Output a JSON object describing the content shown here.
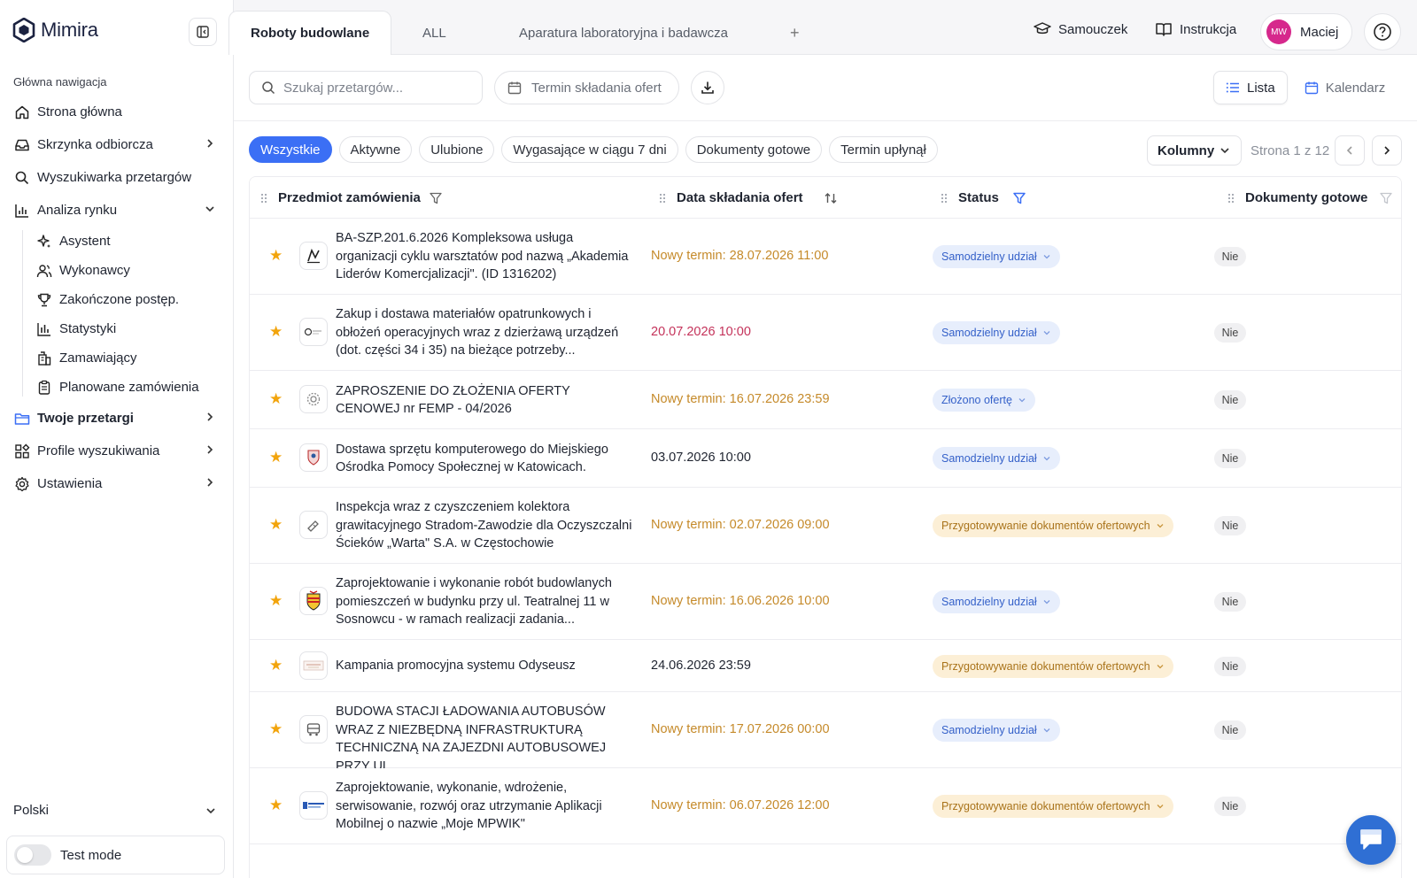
{
  "app": {
    "name": "Mimira"
  },
  "tabs": {
    "items": [
      {
        "label": "Roboty budowlane"
      },
      {
        "label": "ALL"
      },
      {
        "label": "Aparatura laboratoryjna i badawcza"
      }
    ],
    "add_label": "+"
  },
  "top_actions": {
    "tutorial_label": "Samouczek",
    "manual_label": "Instrukcja",
    "user_initials": "MW",
    "user_name": "Maciej"
  },
  "sidebar": {
    "heading": "Główna nawigacja",
    "items": [
      {
        "label": "Strona główna",
        "icon": "home-icon"
      },
      {
        "label": "Skrzynka odbiorcza",
        "icon": "inbox-icon"
      },
      {
        "label": "Wyszukiwarka przetargów",
        "icon": "search-icon"
      },
      {
        "label": "Analiza rynku",
        "icon": "chart-icon"
      }
    ],
    "subitems": [
      {
        "label": "Asystent",
        "icon": "sparkles-icon"
      },
      {
        "label": "Wykonawcy",
        "icon": "users-icon"
      },
      {
        "label": "Zakończone postęp.",
        "icon": "trophy-icon"
      },
      {
        "label": "Statystyki",
        "icon": "bar-chart-icon"
      },
      {
        "label": "Zamawiający",
        "icon": "building-icon"
      },
      {
        "label": "Planowane zamówienia",
        "icon": "clipboard-icon"
      }
    ],
    "items_after": [
      {
        "label": "Twoje przetargi",
        "icon": "folder-icon"
      },
      {
        "label": "Profile wyszukiwania",
        "icon": "widgets-icon"
      },
      {
        "label": "Ustawienia",
        "icon": "gear-icon"
      }
    ],
    "language": "Polski",
    "test_mode_label": "Test mode"
  },
  "toolbar": {
    "search_placeholder": "Szukaj przetargów...",
    "date_filter_label": "Termin składania ofert",
    "view_list_label": "Lista",
    "view_calendar_label": "Kalendarz"
  },
  "filters": {
    "chips": [
      "Wszystkie",
      "Aktywne",
      "Ulubione",
      "Wygasające w ciągu 7 dni",
      "Dokumenty gotowe",
      "Termin upłynął"
    ],
    "columns_label": "Kolumny",
    "page_info": "Strona 1 z 12"
  },
  "table": {
    "headers": {
      "subject": "Przedmiot zamówienia",
      "date": "Data składania ofert",
      "status": "Status",
      "docs": "Dokumenty gotowe"
    },
    "rows": [
      {
        "subject": "BA-SZP.201.6.2026 Kompleksowa usługa organizacji cyklu warsztatów pod nazwą „Akademia Liderów Komercjalizacji\". (ID 1316202)",
        "date": "Nowy termin: 28.07.2026 11:00",
        "date_style": "orange",
        "status": "Samodzielny udział",
        "status_style": "blue",
        "docs": "Nie",
        "lines": 3
      },
      {
        "subject": "Zakup i dostawa materiałów opatrunkowych i obłożeń operacyjnych wraz z dzierżawą urządzeń (dot. części 34 i 35) na bieżące potrzeby...",
        "date": "20.07.2026 10:00",
        "date_style": "red",
        "status": "Samodzielny udział",
        "status_style": "blue",
        "docs": "Nie",
        "lines": 3
      },
      {
        "subject": "ZAPROSZENIE DO ZŁOŻENIA OFERTY CENOWEJ nr FEMP - 04/2026",
        "date": "Nowy termin: 16.07.2026 23:59",
        "date_style": "orange",
        "status": "Złożono ofertę",
        "status_style": "blue",
        "docs": "Nie",
        "lines": 2
      },
      {
        "subject": "Dostawa sprzętu komputerowego do Miejskiego Ośrodka Pomocy Społecznej w Katowicach.",
        "date": "03.07.2026 10:00",
        "date_style": "plain",
        "status": "Samodzielny udział",
        "status_style": "blue",
        "docs": "Nie",
        "lines": 2
      },
      {
        "subject": "Inspekcja wraz z czyszczeniem kolektora grawitacyjnego Stradom-Zawodzie dla Oczyszczalni Ścieków „Warta\" S.A. w Częstochowie",
        "date": "Nowy termin: 02.07.2026 09:00",
        "date_style": "orange",
        "status": "Przygotowywanie dokumentów ofertowych",
        "status_style": "yellow",
        "docs": "Nie",
        "lines": 3
      },
      {
        "subject": "Zaprojektowanie i wykonanie robót budowlanych pomieszczeń w budynku przy ul. Teatralnej 11 w Sosnowcu - w ramach realizacji zadania...",
        "date": "Nowy termin: 16.06.2026 10:00",
        "date_style": "orange",
        "status": "Samodzielny udział",
        "status_style": "blue",
        "docs": "Nie",
        "lines": 3
      },
      {
        "subject": "Kampania promocyjna systemu Odyseusz",
        "date": "24.06.2026 23:59",
        "date_style": "plain",
        "status": "Przygotowywanie dokumentów ofertowych",
        "status_style": "yellow",
        "docs": "Nie",
        "lines": 1
      },
      {
        "subject": "BUDOWA STACJI ŁADOWANIA AUTOBUSÓW WRAZ Z NIEZBĘDNĄ INFRASTRUKTURĄ TECHNICZNĄ NA ZAJEZDNI AUTOBUSOWEJ PRZY UL....",
        "date": "Nowy termin: 17.07.2026 00:00",
        "date_style": "orange",
        "status": "Samodzielny udział",
        "status_style": "blue",
        "docs": "Nie",
        "lines": 3
      },
      {
        "subject": "Zaprojektowanie, wykonanie, wdrożenie, serwisowanie, rozwój oraz utrzymanie Aplikacji Mobilnej o nazwie „Moje MPWIK\"",
        "date": "Nowy termin: 06.07.2026 12:00",
        "date_style": "orange",
        "status": "Przygotowywanie dokumentów ofertowych",
        "status_style": "yellow",
        "docs": "Nie",
        "lines": 3
      }
    ]
  },
  "colors": {
    "accent": "#3b6ff5",
    "brand": "#1b2240",
    "avatar": "#d6288c",
    "favorite": "#f2a40c"
  }
}
